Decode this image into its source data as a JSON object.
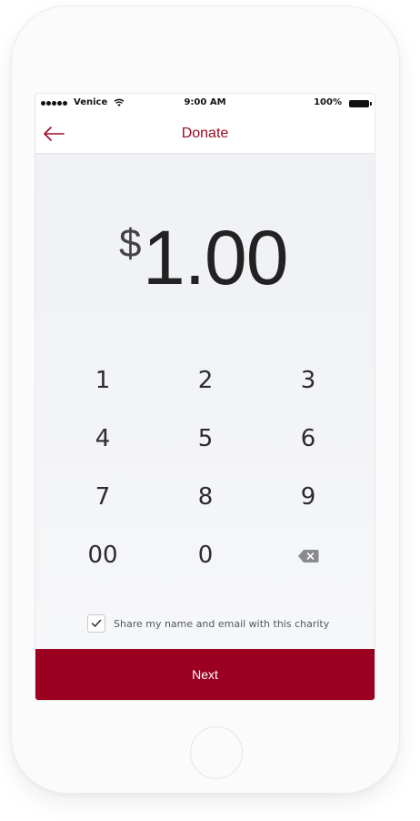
{
  "status_bar": {
    "carrier": "Venice",
    "time": "9:00 AM",
    "battery": "100%"
  },
  "nav": {
    "back_icon": "arrow-left-icon",
    "title": "Donate"
  },
  "amount": {
    "currency": "$",
    "value": "1.00"
  },
  "keypad": {
    "keys": [
      "1",
      "2",
      "3",
      "4",
      "5",
      "6",
      "7",
      "8",
      "9",
      "00",
      "0"
    ],
    "delete_icon": "backspace-icon"
  },
  "consent": {
    "checked": true,
    "label": "Share my name and email with this charity"
  },
  "next_button": {
    "label": "Next"
  },
  "colors": {
    "accent": "#9b0020",
    "title": "#9b0b25"
  }
}
